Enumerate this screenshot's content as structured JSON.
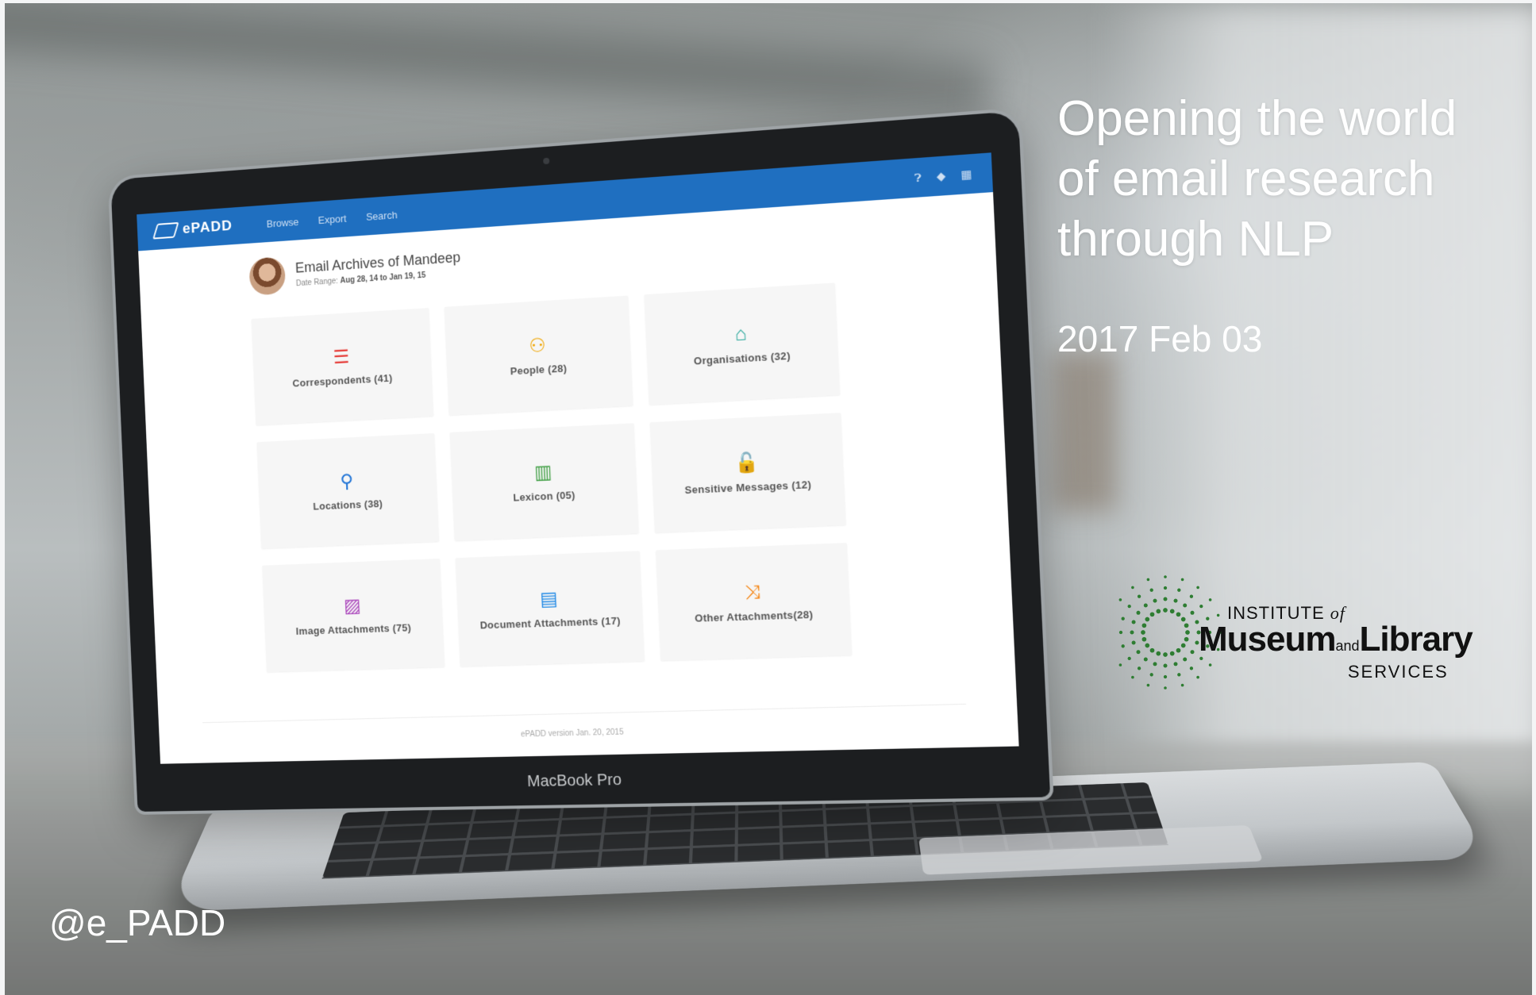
{
  "slide": {
    "title_lines": [
      "Opening the world",
      "of email research",
      "through NLP"
    ],
    "date": "2017 Feb 03",
    "handle": "@e_PADD"
  },
  "logo": {
    "institute": "INSTITUTE",
    "of": "of",
    "museum": "Museum",
    "and": "and",
    "library": "Library",
    "services": "SERVICES",
    "dot_color": "#2e7d32"
  },
  "laptop": {
    "brand": "MacBook Pro"
  },
  "app": {
    "logo_text": "ePADD",
    "nav": [
      "Browse",
      "Export",
      "Search"
    ],
    "header_color": "#1f6fc0",
    "archive_title": "Email Archives of Mandeep",
    "date_range_label": "Date Range:",
    "date_range_value": "Aug 28, 14 to Jan 19, 15",
    "tiles": [
      {
        "label": "Correspondents (41)",
        "icon": "list-icon",
        "glyph": "☰",
        "color": "#e53935"
      },
      {
        "label": "People (28)",
        "icon": "person-icon",
        "glyph": "⚇",
        "color": "#f0a500"
      },
      {
        "label": "Organisations (32)",
        "icon": "home-icon",
        "glyph": "⌂",
        "color": "#26a69a"
      },
      {
        "label": "Locations (38)",
        "icon": "map-pin-icon",
        "glyph": "⚲",
        "color": "#1e73d6"
      },
      {
        "label": "Lexicon (05)",
        "icon": "book-icon",
        "glyph": "▥",
        "color": "#43a047"
      },
      {
        "label": "Sensitive Messages (12)",
        "icon": "lock-icon",
        "glyph": "🔓",
        "color": "#e65100"
      },
      {
        "label": "Image Attachments (75)",
        "icon": "image-icon",
        "glyph": "▨",
        "color": "#ab47bc"
      },
      {
        "label": "Document Attachments (17)",
        "icon": "document-icon",
        "glyph": "▤",
        "color": "#1e88e5"
      },
      {
        "label": "Other Attachments(28)",
        "icon": "shuffle-icon",
        "glyph": "⤨",
        "color": "#f57c00"
      }
    ],
    "footer": "ePADD version Jan. 20, 2015"
  }
}
